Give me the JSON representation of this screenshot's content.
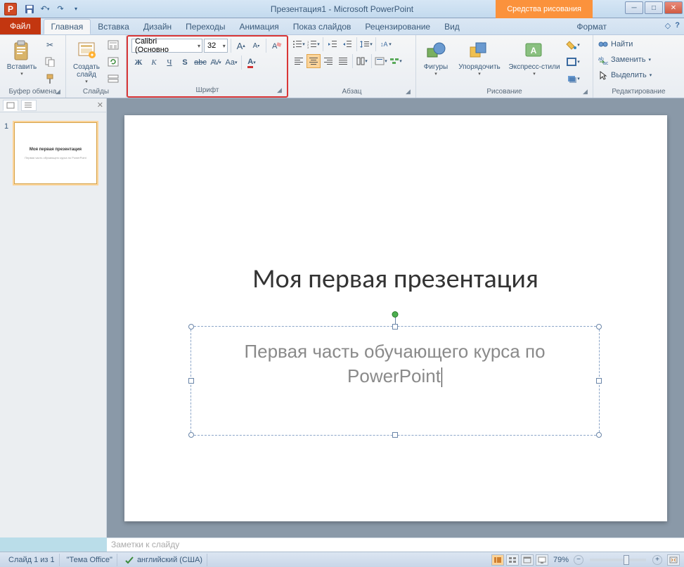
{
  "app": {
    "title": "Презентация1 - Microsoft PowerPoint",
    "icon_letter": "P"
  },
  "context_tools": "Средства рисования",
  "qat": {
    "save": "💾",
    "undo": "↶",
    "redo": "↷"
  },
  "tabs": {
    "file": "Файл",
    "items": [
      "Главная",
      "Вставка",
      "Дизайн",
      "Переходы",
      "Анимация",
      "Показ слайдов",
      "Рецензирование",
      "Вид"
    ],
    "context": "Формат",
    "active": "Главная"
  },
  "ribbon": {
    "clipboard": {
      "label": "Буфер обмена",
      "paste": "Вставить"
    },
    "slides": {
      "label": "Слайды",
      "new_slide": "Создать\nслайд"
    },
    "font": {
      "label": "Шрифт",
      "name": "Calibri (Основно",
      "size": "32"
    },
    "paragraph": {
      "label": "Абзац"
    },
    "drawing": {
      "label": "Рисование",
      "shapes": "Фигуры",
      "arrange": "Упорядочить",
      "quick_styles": "Экспресс-стили"
    },
    "editing": {
      "label": "Редактирование",
      "find": "Найти",
      "replace": "Заменить",
      "select": "Выделить"
    }
  },
  "slide": {
    "number": "1",
    "title": "Моя первая презентация",
    "subtitle": "Первая часть обучающего курса по PowerPoint",
    "thumb_title": "Моя первая презентация",
    "thumb_sub": "Первая часть обучающего курса по PowerPoint"
  },
  "notes_placeholder": "Заметки к слайду",
  "status": {
    "slide_count": "Слайд 1 из 1",
    "theme": "\"Тема Office\"",
    "language": "английский (США)",
    "zoom": "79%"
  }
}
